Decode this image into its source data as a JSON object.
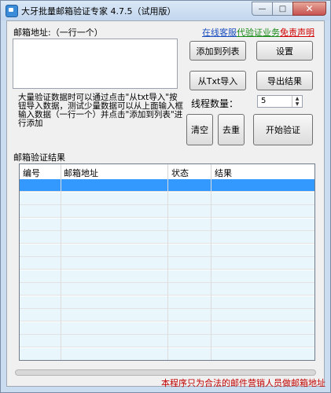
{
  "window": {
    "title": "大牙批量邮箱验证专家 4.7.5（试用版）",
    "controls": {
      "minimize": "—",
      "maximize": "□",
      "close": "✕"
    }
  },
  "input_section": {
    "label": "邮箱地址:（一行一个）",
    "value": "",
    "hint": "大量验证数据时可以通过点击\"从txt导入\"按钮导入数据，测试少量数据可以从上面输入框输入数据（一行一个）并点击\"添加到列表\"进行添加"
  },
  "links": {
    "online_support": "在线客服",
    "verify_service": "代验证业务",
    "disclaimer": "免责声明"
  },
  "buttons": {
    "add_to_list": "添加到列表",
    "settings": "设置",
    "import_txt": "从Txt导入",
    "export_results": "导出结果",
    "clear": "清空",
    "dedupe": "去重",
    "start_verify": "开始验证"
  },
  "threads": {
    "label": "线程数量：",
    "value": "5"
  },
  "results": {
    "label": "邮箱验证结果",
    "columns": [
      "编号",
      "邮箱地址",
      "状态",
      "结果"
    ],
    "rows": 14
  },
  "footer": {
    "text": "本程序只为合法的邮件营销人员做邮箱地址"
  },
  "colors": {
    "link_blue": "#1a4fbf",
    "link_green": "#1a8a1a",
    "link_red": "#d00000",
    "footer_red": "#c00000",
    "selection": "#3399ff"
  }
}
